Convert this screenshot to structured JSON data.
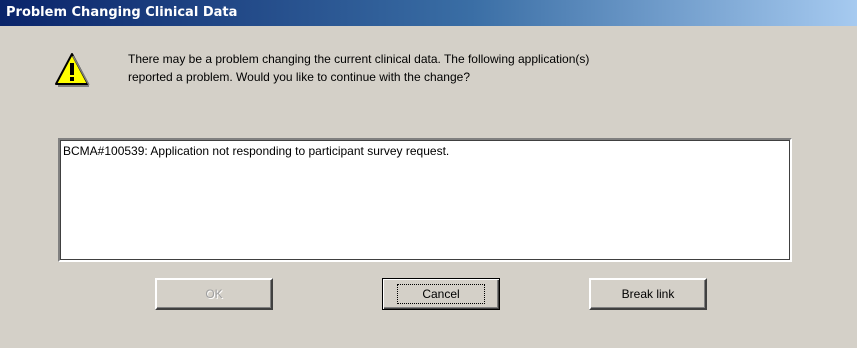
{
  "dialog": {
    "title": "Problem Changing Clinical Data",
    "message": "There may be a problem changing the current clinical data.  The following application(s)\nreported a problem.  Would you like to continue with the change?",
    "details": "BCMA#100539: Application not responding to participant survey request.",
    "icon": "warning-icon"
  },
  "buttons": {
    "ok": "OK",
    "cancel": "Cancel",
    "break_link": "Break link"
  }
}
